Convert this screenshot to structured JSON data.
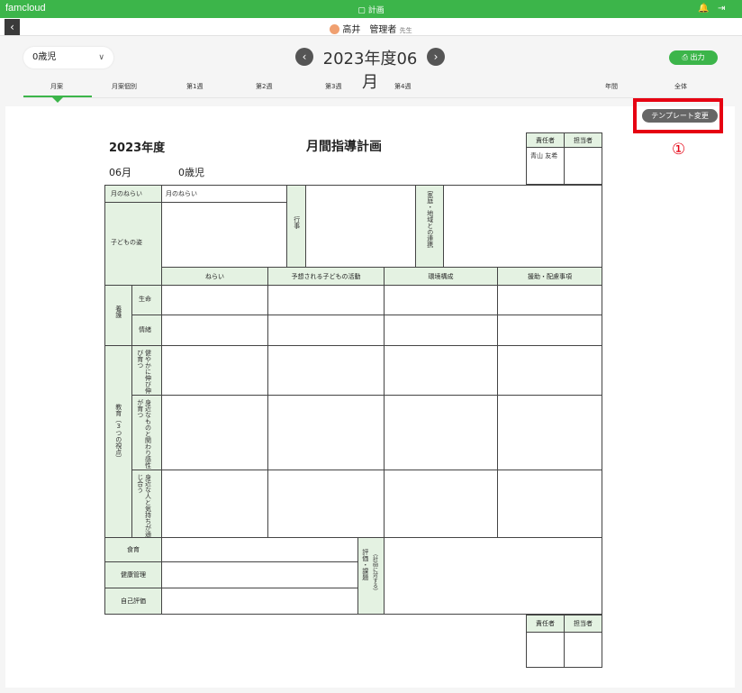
{
  "app": {
    "logo": "famcloud",
    "center_title": "計画",
    "user_name": "高井　管理者",
    "user_suffix": "先生"
  },
  "toolbar": {
    "age_select": "0歳児",
    "month_title": "2023年度06月",
    "print_label": "出力",
    "template_change": "テンプレート変更",
    "annotation_marker": "①"
  },
  "tabs": [
    {
      "label": "月案",
      "active": true
    },
    {
      "label": "月案個別"
    },
    {
      "label": "第1週"
    },
    {
      "label": "第2週"
    },
    {
      "label": "第3週"
    },
    {
      "label": "第4週"
    },
    {
      "label": "年間"
    },
    {
      "label": "全体"
    }
  ],
  "doc": {
    "year": "2023年度",
    "title": "月間指導計画",
    "month": "06月",
    "age": "0歳児",
    "responsible": "責任者",
    "in_charge": "担当者",
    "responsible_name": "青山 友希",
    "monthly_aim": "月のねらい",
    "monthly_aim_value": "月のねらい",
    "events": "行事",
    "family": "家庭・地域との連携",
    "child_state": "子どもの姿",
    "col_aim": "ねらい",
    "col_activity": "予想される子どもの活動",
    "col_environment": "環境構成",
    "col_support": "援助・配慮事項",
    "care": "養護",
    "life": "生命",
    "emotion": "情緒",
    "education": "教育（3つの視点）",
    "view1": "健やかに伸び伸び育つ",
    "view2": "身近なものと関わり感性が育つ",
    "view3": "身近な人と気持ちが通じ合う",
    "food": "食育",
    "health": "健康管理",
    "self_eval": "自己評価",
    "evaluation": "評価・課題",
    "evaluation_sub": "（計画に対する）"
  },
  "colors": {
    "brand": "#3cb54a",
    "header_cell": "#e4f2e2",
    "highlight": "#e60012"
  }
}
